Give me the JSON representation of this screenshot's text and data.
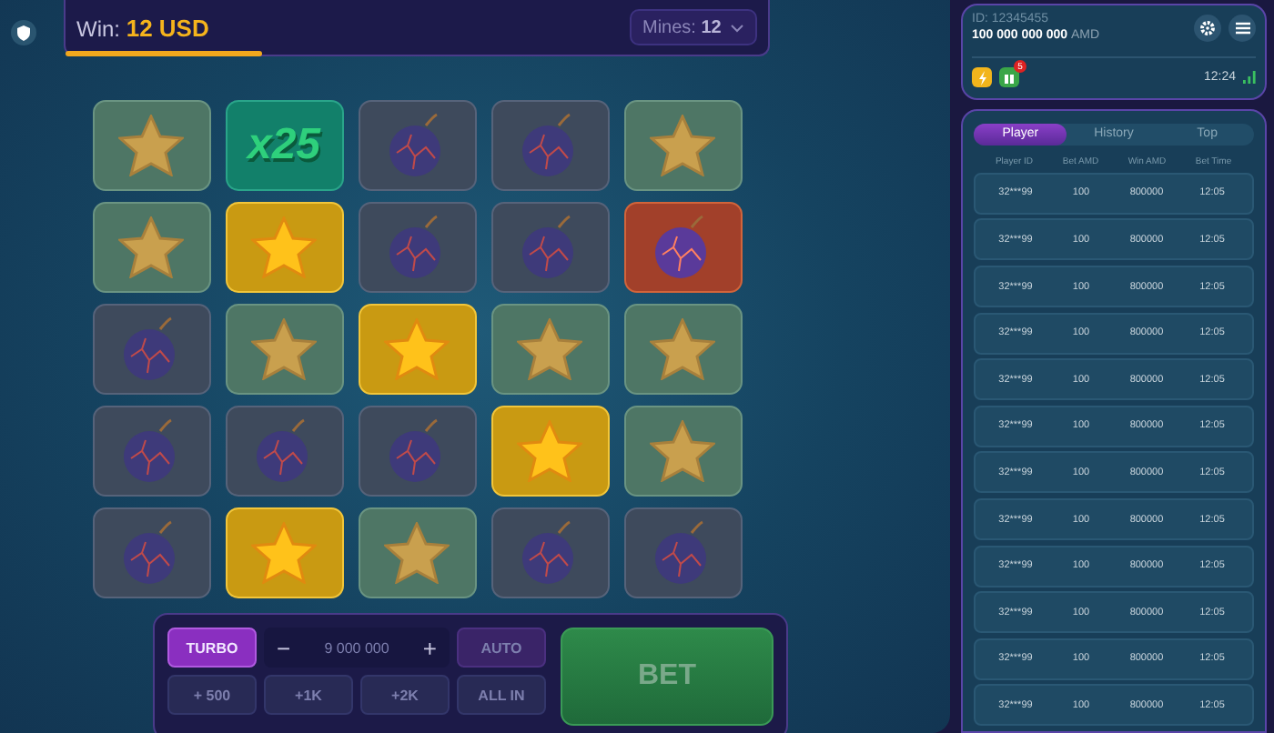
{
  "top_bar": {
    "win_label": "Win:",
    "win_value": "12 USD",
    "level": 0.28,
    "mines": {
      "label": "Mines:",
      "value": "12"
    }
  },
  "grid": [
    [
      {
        "kind": "star"
      },
      {
        "kind": "multiplier",
        "text": "x25"
      },
      {
        "kind": "bomb"
      },
      {
        "kind": "bomb"
      },
      {
        "kind": "star"
      }
    ],
    [
      {
        "kind": "star"
      },
      {
        "kind": "star-picked"
      },
      {
        "kind": "bomb"
      },
      {
        "kind": "bomb"
      },
      {
        "kind": "bomb-hit"
      }
    ],
    [
      {
        "kind": "bomb"
      },
      {
        "kind": "star"
      },
      {
        "kind": "star-picked"
      },
      {
        "kind": "star"
      },
      {
        "kind": "star"
      }
    ],
    [
      {
        "kind": "bomb"
      },
      {
        "kind": "bomb"
      },
      {
        "kind": "bomb"
      },
      {
        "kind": "star-picked"
      },
      {
        "kind": "star"
      }
    ],
    [
      {
        "kind": "bomb"
      },
      {
        "kind": "star-picked"
      },
      {
        "kind": "star"
      },
      {
        "kind": "bomb"
      },
      {
        "kind": "bomb"
      }
    ]
  ],
  "controls": {
    "turbo": "TURBO",
    "minus": "−",
    "amount": "9 000 000",
    "plus": "+",
    "auto": "AUTO",
    "quick": [
      "+ 500",
      "+1K",
      "+2K",
      "ALL IN"
    ],
    "bet": "BET"
  },
  "account": {
    "id": "ID: 12345455",
    "balance": "100 000 000 000",
    "currency": "AMD",
    "badge": "5",
    "time": "12:24"
  },
  "tabs": [
    {
      "label": "Player",
      "selected": true
    },
    {
      "label": "History",
      "selected": false
    },
    {
      "label": "Top",
      "selected": false
    }
  ],
  "table": {
    "columns": [
      "Player ID",
      "Bet AMD",
      "Win AMD",
      "Bet Time"
    ],
    "rows": [
      [
        "32***99",
        "100",
        "800000",
        "12:05"
      ],
      [
        "32***99",
        "100",
        "800000",
        "12:05"
      ],
      [
        "32***99",
        "100",
        "800000",
        "12:05"
      ],
      [
        "32***99",
        "100",
        "800000",
        "12:05"
      ],
      [
        "32***99",
        "100",
        "800000",
        "12:05"
      ],
      [
        "32***99",
        "100",
        "800000",
        "12:05"
      ],
      [
        "32***99",
        "100",
        "800000",
        "12:05"
      ],
      [
        "32***99",
        "100",
        "800000",
        "12:05"
      ],
      [
        "32***99",
        "100",
        "800000",
        "12:05"
      ],
      [
        "32***99",
        "100",
        "800000",
        "12:05"
      ],
      [
        "32***99",
        "100",
        "800000",
        "12:05"
      ],
      [
        "32***99",
        "100",
        "800000",
        "12:05"
      ]
    ]
  }
}
